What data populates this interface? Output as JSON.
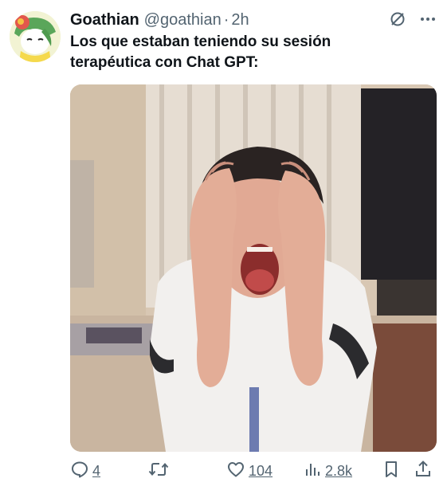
{
  "author": {
    "name": "Goathian",
    "handle": "@goathian",
    "separator": "·",
    "time": "2h"
  },
  "tweet": {
    "text_line1": "Los que estaban teniendo su sesión",
    "text_line2": "terapéutica con Chat GPT:"
  },
  "actions": {
    "reply_count": "4",
    "like_count": "104",
    "views_count": "2.8k"
  },
  "colors": {
    "text": "#0f1419",
    "secondary": "#536471"
  },
  "icons": {
    "header": [
      "grok-icon",
      "more-icon"
    ],
    "actions": [
      "reply-icon",
      "retweet-icon",
      "like-icon",
      "views-icon",
      "bookmark-icon",
      "share-icon"
    ]
  }
}
